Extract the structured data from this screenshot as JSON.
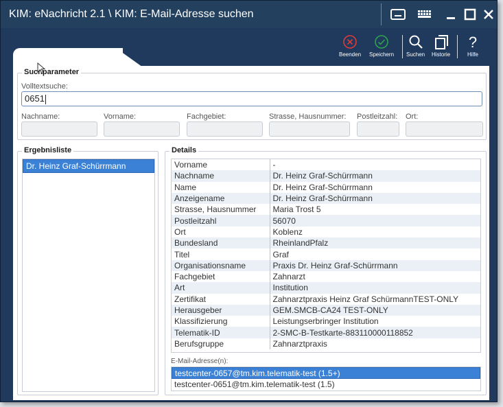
{
  "window": {
    "title": "KIM: eNachricht 2.1 \\ KIM: E-Mail-Adresse suchen"
  },
  "toolbar": {
    "beenden": "Beenden",
    "speichern": "Speichern",
    "suchen": "Suchen",
    "historie": "Historie",
    "hilfe": "Hilfe"
  },
  "colors": {
    "title_bg": "#23405f",
    "accent": "#3b82d6",
    "close_red": "#e03a3a",
    "save_green": "#2ea44f"
  },
  "search": {
    "legend": "Suchparameter",
    "volltext_label": "Volltextsuche:",
    "volltext_value": "0651",
    "nachname_label": "Nachname:",
    "vorname_label": "Vorname:",
    "fachgebiet_label": "Fachgebiet:",
    "strasse_label": "Strasse, Hausnummer:",
    "plz_label": "Postleitzahl:",
    "ort_label": "Ort:"
  },
  "results": {
    "legend": "Ergebnisliste",
    "items": [
      "Dr. Heinz Graf-Schürrmann"
    ]
  },
  "details": {
    "legend": "Details",
    "rows": [
      [
        "Vorname",
        "-"
      ],
      [
        "Nachname",
        "Dr. Heinz Graf-Schürrmann"
      ],
      [
        "Name",
        "Dr. Heinz Graf-Schürrmann"
      ],
      [
        "Anzeigename",
        "Dr. Heinz Graf-Schürrmann"
      ],
      [
        "Strasse, Hausnummer",
        "Maria Trost 5"
      ],
      [
        "Postleitzahl",
        "56070"
      ],
      [
        "Ort",
        "Koblenz"
      ],
      [
        "Bundesland",
        "RheinlandPfalz"
      ],
      [
        "Titel",
        "Graf"
      ],
      [
        "Organisationsname",
        "Praxis Dr. Heinz Graf-Schürrmann"
      ],
      [
        "Fachgebiet",
        "Zahnarzt"
      ],
      [
        "Art",
        "Institution"
      ],
      [
        "Zertifikat",
        "Zahnarztpraxis Heinz Graf SchürmannTEST-ONLY"
      ],
      [
        "Herausgeber",
        "GEM.SMCB-CA24 TEST-ONLY"
      ],
      [
        "Klassifizierung",
        "Leistungserbringer Institution"
      ],
      [
        "Telematik-ID",
        "2-SMC-B-Testkarte-883110000118852"
      ],
      [
        "Berufsgruppe",
        "Zahnarztpraxis"
      ]
    ],
    "email_label": "E-Mail-Adresse(n):",
    "emails": [
      "testcenter-0657@tm.kim.telematik-test (1.5+)",
      "testcenter-0651@tm.kim.telematik-test (1.5)"
    ]
  }
}
